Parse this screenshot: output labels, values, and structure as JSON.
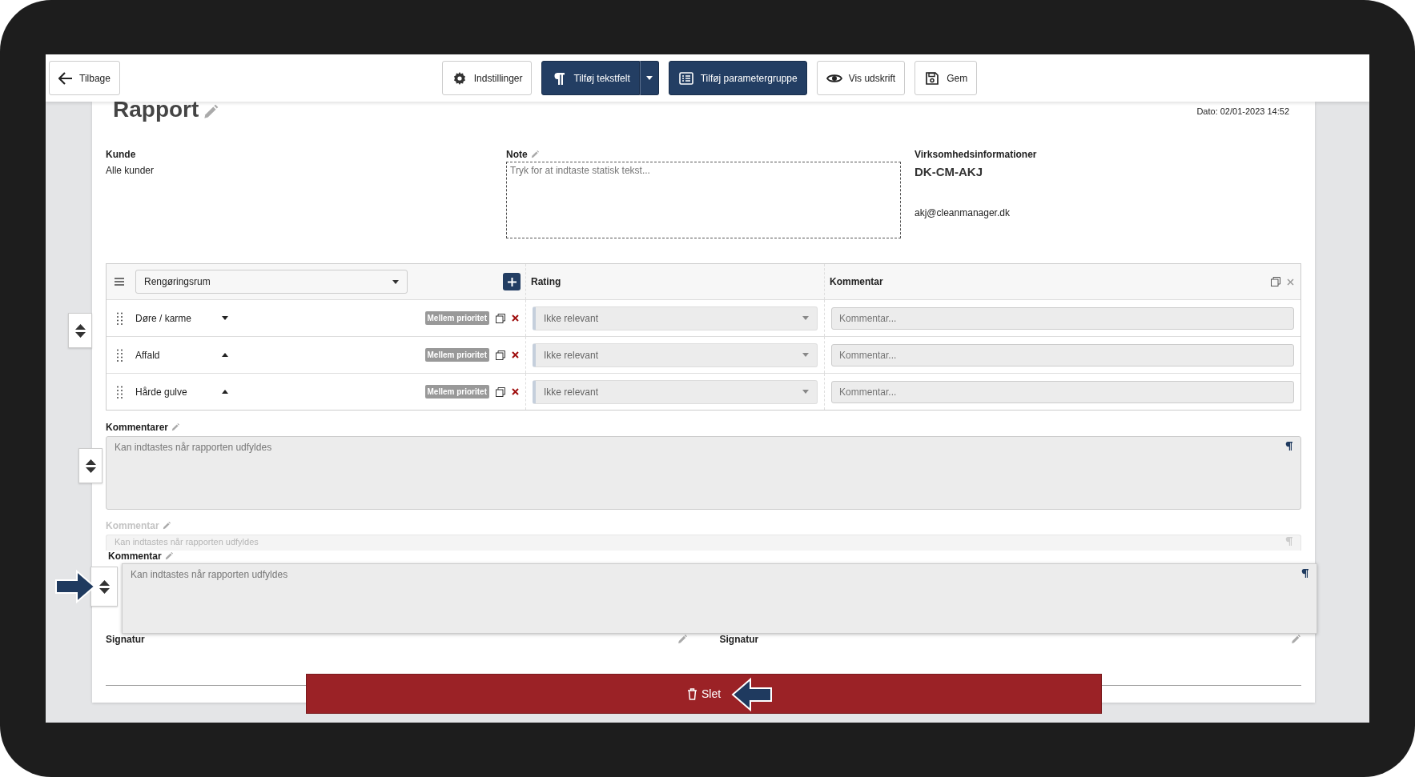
{
  "toolbar": {
    "back": "Tilbage",
    "buttons": [
      {
        "label": "Indstillinger",
        "kind": "settings",
        "primary": false,
        "split": false
      },
      {
        "label": "Tilføj tekstfelt",
        "kind": "text",
        "primary": true,
        "split": true
      },
      {
        "label": "Tilføj parametergruppe",
        "kind": "list",
        "primary": true,
        "split": false
      },
      {
        "label": "Vis udskrift",
        "kind": "preview",
        "primary": false,
        "split": false
      },
      {
        "label": "Gem",
        "kind": "save",
        "primary": false,
        "split": false
      }
    ]
  },
  "report": {
    "title": "Rapport",
    "date": "Dato: 02/01-2023 14:52"
  },
  "customer": {
    "label": "Kunde",
    "value": "Alle kunder"
  },
  "note": {
    "label": "Note",
    "placeholder": "Tryk for at indtaste statisk tekst..."
  },
  "company": {
    "label": "Virksomhedsinformationer",
    "name": "DK-CM-AKJ",
    "email": "akj@cleanmanager.dk"
  },
  "group": {
    "selector": "Rengøringsrum",
    "columns": [
      "Rating",
      "Kommentar"
    ],
    "rows": [
      {
        "name": "Døre / karme",
        "expanded": false,
        "priority": "Mellem prioritet",
        "rating": "Ikke relevant",
        "comment_placeholder": "Kommentar..."
      },
      {
        "name": "Affald",
        "expanded": true,
        "priority": "Mellem prioritet",
        "rating": "Ikke relevant",
        "comment_placeholder": "Kommentar..."
      },
      {
        "name": "Hårde gulve",
        "expanded": true,
        "priority": "Mellem prioritet",
        "rating": "Ikke relevant",
        "comment_placeholder": "Kommentar..."
      }
    ]
  },
  "text_field": {
    "label": "Kommentarer",
    "placeholder": "Kan indtastes når rapporten udfyldes"
  },
  "drop_placeholder": {
    "label": "Kommentar",
    "placeholder": "Kan indtastes når rapporten udfyldes"
  },
  "dragged_field": {
    "label": "Kommentar",
    "placeholder": "Kan indtastes når rapporten udfyldes"
  },
  "signatures": [
    "Signatur",
    "Signatur"
  ],
  "delete_button": "Slet"
}
